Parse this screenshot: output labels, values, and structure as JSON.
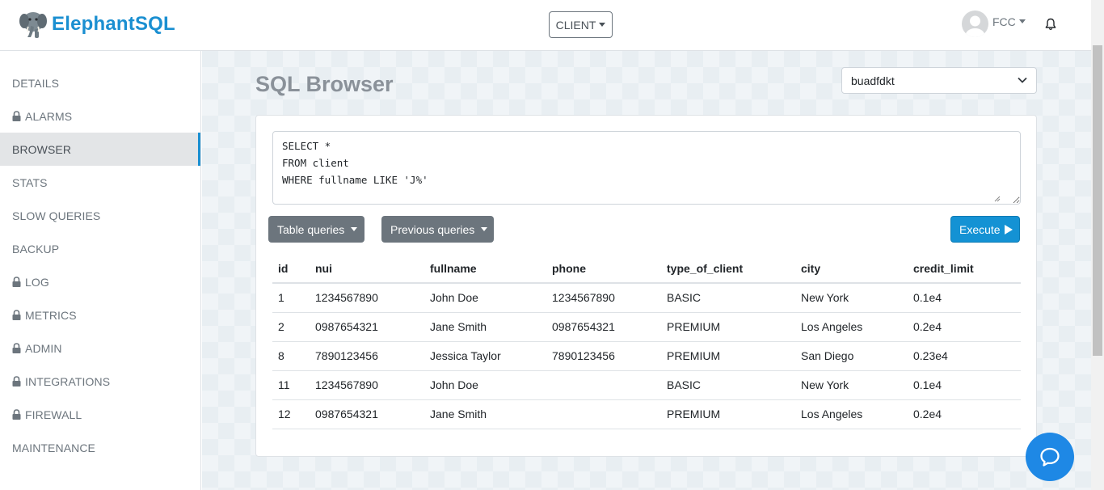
{
  "header": {
    "brand": "ElephantSQL",
    "instance_button": "CLIENT",
    "user_name": "FCC"
  },
  "sidebar": {
    "items": [
      {
        "label": "DETAILS",
        "locked": false,
        "active": false
      },
      {
        "label": "ALARMS",
        "locked": true,
        "active": false
      },
      {
        "label": "BROWSER",
        "locked": false,
        "active": true
      },
      {
        "label": "STATS",
        "locked": false,
        "active": false
      },
      {
        "label": "SLOW QUERIES",
        "locked": false,
        "active": false
      },
      {
        "label": "BACKUP",
        "locked": false,
        "active": false
      },
      {
        "label": "LOG",
        "locked": true,
        "active": false
      },
      {
        "label": "METRICS",
        "locked": true,
        "active": false
      },
      {
        "label": "ADMIN",
        "locked": true,
        "active": false
      },
      {
        "label": "INTEGRATIONS",
        "locked": true,
        "active": false
      },
      {
        "label": "FIREWALL",
        "locked": true,
        "active": false
      },
      {
        "label": "MAINTENANCE",
        "locked": false,
        "active": false
      }
    ]
  },
  "main": {
    "title": "SQL Browser",
    "database_select": "buadfdkt",
    "query": "SELECT *\nFROM client\nWHERE fullname LIKE 'J%'",
    "table_queries_label": "Table queries",
    "previous_queries_label": "Previous queries",
    "execute_label": "Execute"
  },
  "results": {
    "columns": [
      "id",
      "nui",
      "fullname",
      "phone",
      "type_of_client",
      "city",
      "credit_limit"
    ],
    "rows": [
      [
        "1",
        "1234567890",
        "John Doe",
        "1234567890",
        "BASIC",
        "New York",
        "0.1e4"
      ],
      [
        "2",
        "0987654321",
        "Jane Smith",
        "0987654321",
        "PREMIUM",
        "Los Angeles",
        "0.2e4"
      ],
      [
        "8",
        "7890123456",
        "Jessica Taylor",
        "7890123456",
        "PREMIUM",
        "San Diego",
        "0.23e4"
      ],
      [
        "11",
        "1234567890",
        "John Doe",
        "",
        "BASIC",
        "New York",
        "0.1e4"
      ],
      [
        "12",
        "0987654321",
        "Jane Smith",
        "",
        "PREMIUM",
        "Los Angeles",
        "0.2e4"
      ]
    ]
  },
  "colors": {
    "brand": "#1a8fd1",
    "execute": "#1492d4",
    "secondary_button": "#6c757d",
    "chat": "#1e88e5"
  },
  "icons": {
    "logo": "elephant-logo-icon",
    "lock": "lock-icon",
    "bell": "bell-icon",
    "play": "play-icon",
    "chat": "chat-bubble-icon",
    "select_chevron": "chevron-down-icon"
  }
}
